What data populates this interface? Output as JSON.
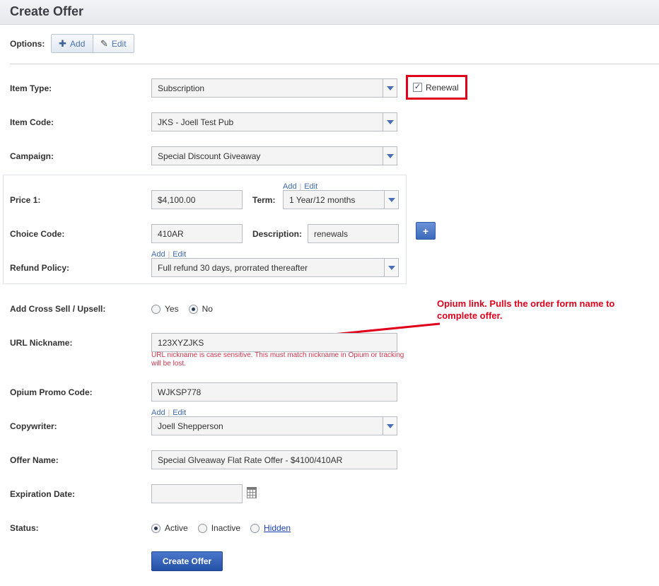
{
  "header": {
    "title": "Create Offer"
  },
  "options": {
    "label": "Options:",
    "add_label": "Add",
    "edit_label": "Edit"
  },
  "item_type": {
    "label": "Item Type:",
    "value": "Subscription",
    "renewal_label": "Renewal",
    "renewal_checked": true
  },
  "item_code": {
    "label": "Item Code:",
    "value": "JKS - Joell Test Pub"
  },
  "campaign": {
    "label": "Campaign:",
    "value": "Special Discount Giveaway"
  },
  "price_panel": {
    "price_label": "Price 1:",
    "price_value": "$4,100.00",
    "term_label": "Term:",
    "term_value": "1 Year/12 months",
    "term_add": "Add",
    "term_edit": "Edit",
    "choice_label": "Choice Code:",
    "choice_value": "410AR",
    "description_label": "Description:",
    "description_value": "renewals",
    "refund_label": "Refund Policy:",
    "refund_value": "Full refund 30 days, prorrated thereafter",
    "refund_add": "Add",
    "refund_edit": "Edit",
    "plus_button": "+"
  },
  "cross_sell": {
    "label": "Add Cross Sell / Upsell:",
    "yes": "Yes",
    "no": "No",
    "selected": "No"
  },
  "url_nickname": {
    "label": "URL Nickname:",
    "value": "123XYZJKS",
    "hint": "URL nickname is case sensitive. This must match nickname in Opium or tracking will be lost."
  },
  "annotation": {
    "text": "Opium link. Pulls the order form name to complete offer."
  },
  "promo_code": {
    "label": "Opium Promo Code:",
    "value": "WJKSP778"
  },
  "copywriter": {
    "label": "Copywriter:",
    "value": "Joell Shepperson",
    "add": "Add",
    "edit": "Edit"
  },
  "offer_name": {
    "label": "Offer Name:",
    "value": "Special Glveaway Flat Rate Offer - $4100/410AR"
  },
  "expiration": {
    "label": "Expiration Date:",
    "value": ""
  },
  "status": {
    "label": "Status:",
    "active": "Active",
    "inactive": "Inactive",
    "hidden": "Hidden",
    "selected": "Active"
  },
  "submit": {
    "label": "Create Offer"
  },
  "colors": {
    "accent": "#3c6abc",
    "annotation": "#e0001b",
    "hint": "#d0334a"
  }
}
